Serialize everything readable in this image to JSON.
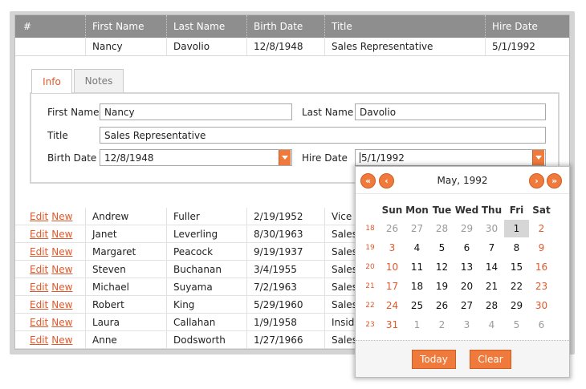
{
  "grid": {
    "columns": [
      "#",
      "First Name",
      "Last Name",
      "Birth Date",
      "Title",
      "Hire Date"
    ],
    "expanded_row": {
      "first": "Nancy",
      "last": "Davolio",
      "birth": "12/8/1948",
      "title": "Sales Representative",
      "hire": "5/1/1992"
    },
    "row_actions": {
      "edit": "Edit",
      "new": "New"
    },
    "rows": [
      {
        "first": "Andrew",
        "last": "Fuller",
        "birth": "2/19/1952",
        "title": "Vice"
      },
      {
        "first": "Janet",
        "last": "Leverling",
        "birth": "8/30/1963",
        "title": "Sales"
      },
      {
        "first": "Margaret",
        "last": "Peacock",
        "birth": "9/19/1937",
        "title": "Sales"
      },
      {
        "first": "Steven",
        "last": "Buchanan",
        "birth": "3/4/1955",
        "title": "Sales"
      },
      {
        "first": "Michael",
        "last": "Suyama",
        "birth": "7/2/1963",
        "title": "Sales"
      },
      {
        "first": "Robert",
        "last": "King",
        "birth": "5/29/1960",
        "title": "Sales"
      },
      {
        "first": "Laura",
        "last": "Callahan",
        "birth": "1/9/1958",
        "title": "Insid"
      },
      {
        "first": "Anne",
        "last": "Dodsworth",
        "birth": "1/27/1966",
        "title": "Sales"
      }
    ]
  },
  "detail": {
    "tabs": [
      "Info",
      "Notes"
    ],
    "labels": {
      "first_name": "First Name",
      "last_name": "Last Name",
      "title": "Title",
      "birth_date": "Birth Date",
      "hire_date": "Hire Date"
    },
    "values": {
      "first_name": "Nancy",
      "last_name": "Davolio",
      "title": "Sales Representative",
      "birth_date": "12/8/1948",
      "hire_date": "5/1/1992"
    }
  },
  "calendar": {
    "title": "May, 1992",
    "nav": {
      "prev_year": "«",
      "prev_month": "‹",
      "next_month": "›",
      "next_year": "»"
    },
    "weekdays": [
      "Sun",
      "Mon",
      "Tue",
      "Wed",
      "Thu",
      "Fri",
      "Sat"
    ],
    "week_numbers": [
      "18",
      "19",
      "20",
      "21",
      "22",
      "23"
    ],
    "weeks": [
      [
        "26",
        "27",
        "28",
        "29",
        "30",
        "1",
        "2"
      ],
      [
        "3",
        "4",
        "5",
        "6",
        "7",
        "8",
        "9"
      ],
      [
        "10",
        "11",
        "12",
        "13",
        "14",
        "15",
        "16"
      ],
      [
        "17",
        "18",
        "19",
        "20",
        "21",
        "22",
        "23"
      ],
      [
        "24",
        "25",
        "26",
        "27",
        "28",
        "29",
        "30"
      ],
      [
        "31",
        "1",
        "2",
        "3",
        "4",
        "5",
        "6"
      ]
    ],
    "selected": "1",
    "buttons": {
      "today": "Today",
      "clear": "Clear"
    }
  },
  "colors": {
    "accent": "#f07a3c",
    "link": "#e2582a",
    "header_bg": "#8e8e8e",
    "selected_day": "#d6d6d6"
  },
  "icons": {
    "dropdown": "triangle-down-icon"
  }
}
